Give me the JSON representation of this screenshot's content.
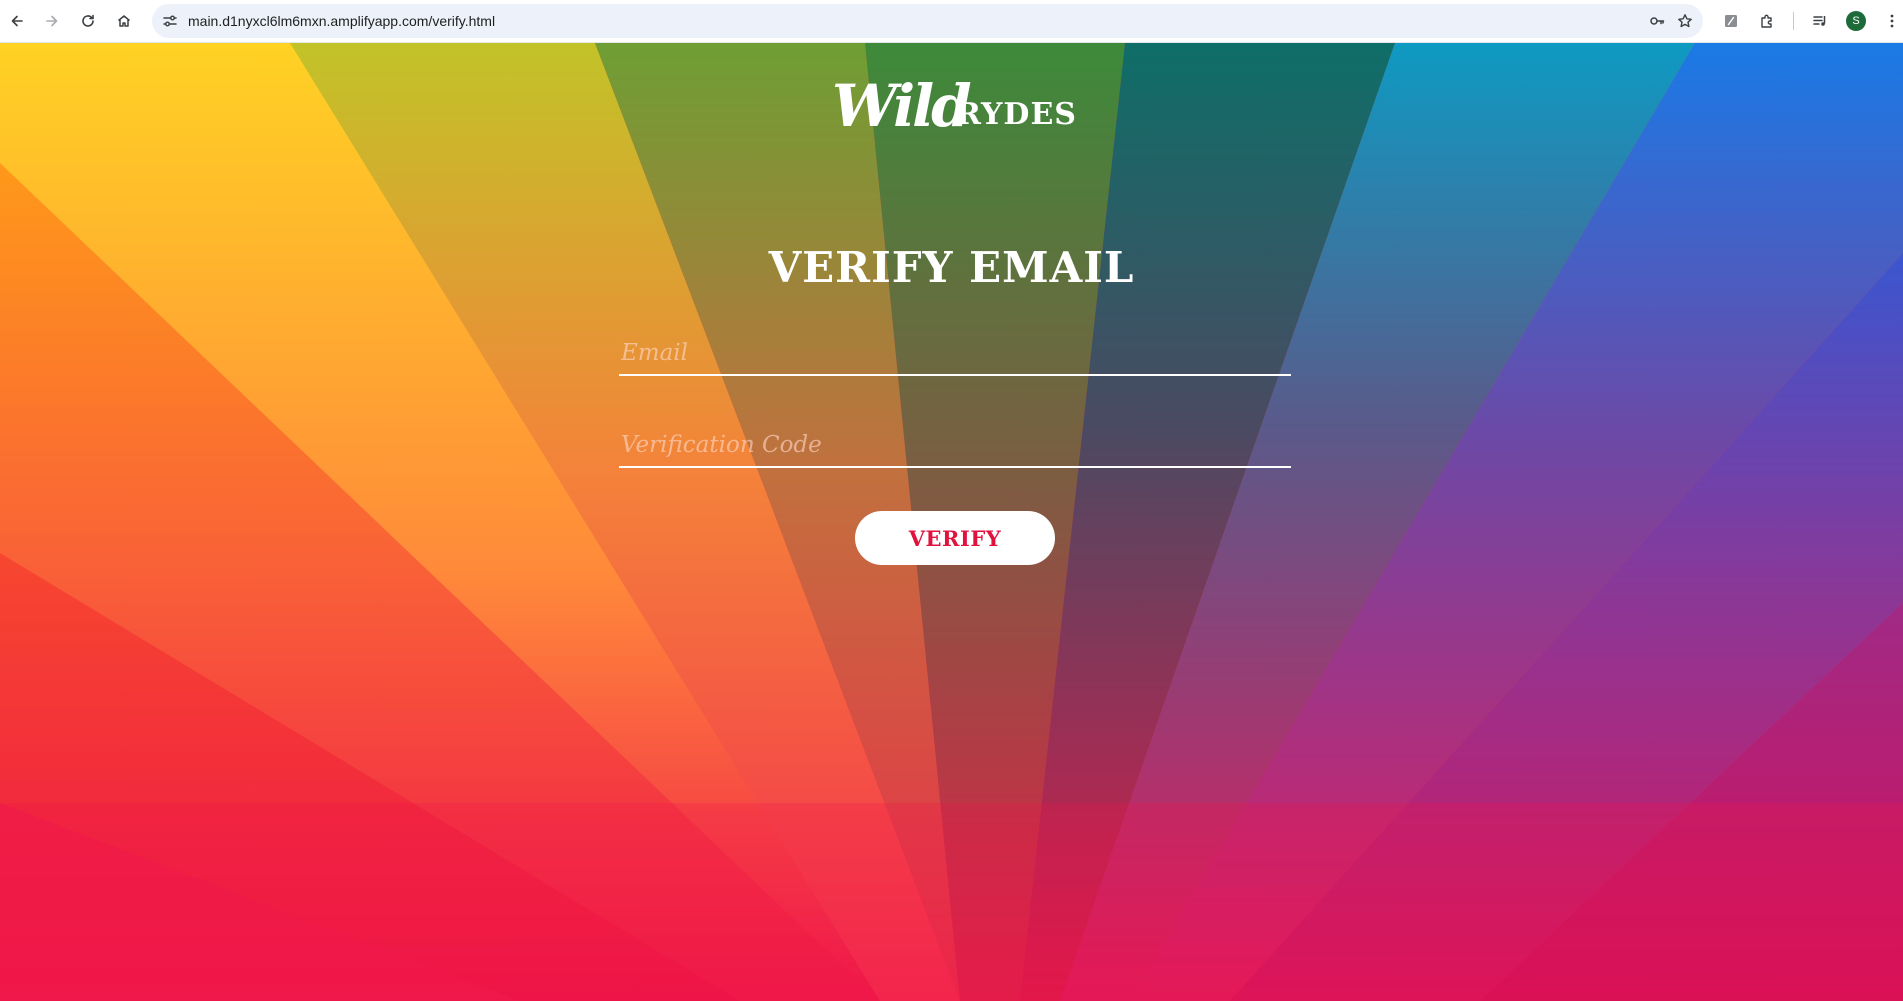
{
  "browser": {
    "url": "main.d1nyxcl6lm6mxn.amplifyapp.com/verify.html",
    "profile_initial": "S",
    "icons": {
      "back": "back-arrow-icon",
      "forward": "forward-arrow-icon",
      "reload": "reload-icon",
      "home": "home-icon",
      "site_info": "site-info-icon",
      "password": "key-icon",
      "bookmark": "star-icon",
      "extension": "extension-icon",
      "extensions_menu": "puzzle-icon",
      "media": "media-control-icon",
      "menu": "kebab-menu-icon"
    }
  },
  "page": {
    "logo": {
      "script": "Wild",
      "word": "RYDES"
    },
    "title": "VERIFY EMAIL",
    "form": {
      "email_placeholder": "Email",
      "email_value": "",
      "code_placeholder": "Verification Code",
      "code_value": "",
      "submit_label": "VERIFY"
    }
  },
  "colors": {
    "accent": "#e0133f",
    "button_bg": "#ffffff",
    "text": "#ffffff"
  }
}
